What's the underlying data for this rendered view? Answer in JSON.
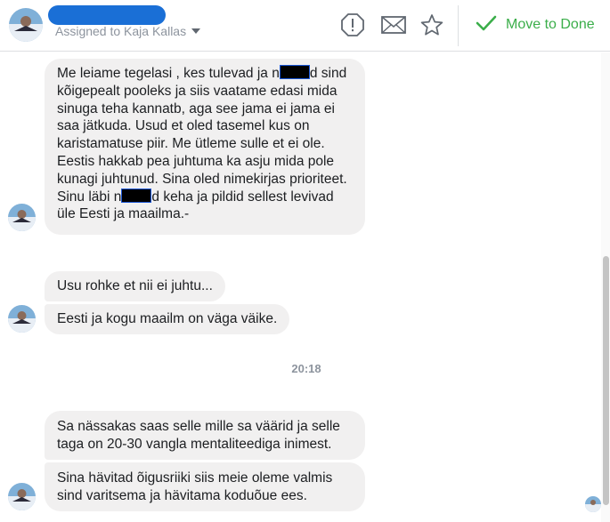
{
  "header": {
    "assigned_label": "Assigned to Kaja Kallas",
    "done_label": "Move to Done",
    "icons": [
      "alert-octagon-icon",
      "envelope-icon",
      "star-icon",
      "checkmark-icon"
    ],
    "accent_color": "#3bae4a",
    "name_redaction_color": "#1a6fd6"
  },
  "messages": [
    {
      "seg_a": "Me leiame tegelasi , kes tulevad ja n",
      "seg_b": "d sind kõigepealt pooleks ja siis vaatame edasi mida sinuga teha kannatb, aga see jama ei jama ei saa jätkuda. Usud et oled tasemel kus on karistamatuse piir. Me ütleme sulle et ei ole. Eestis hakkab pea juhtuma ka asju mida pole kunagi juhtunud. Sina oled nimekirjas prioriteet. Sinu läbi n",
      "seg_c": "d keha ja pildid sellest levivad üle Eesti ja maailma.-"
    },
    {
      "text": "Usu rohke et nii ei juhtu..."
    },
    {
      "text": "Eesti ja kogu maailm on väga väike."
    },
    {
      "text": "Sa nässakas saas selle mille sa väärid ja selle taga on 20-30 vangla mentaliteediga inimest."
    },
    {
      "text": "Sina hävitad õigusriiki siis meie oleme valmis sind varitsema ja hävitama koduõue ees."
    }
  ],
  "timestamp": "20:18",
  "bubble_color": "#f1f0f0"
}
